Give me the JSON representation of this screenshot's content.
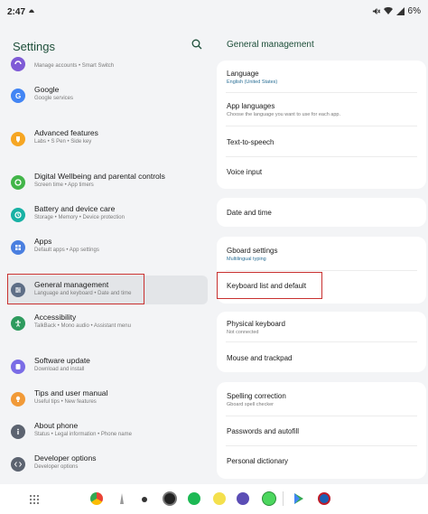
{
  "status_bar": {
    "time": "2:47",
    "battery": "6%"
  },
  "left": {
    "title": "Settings",
    "items": [
      {
        "label": "",
        "sub": "Manage accounts  •  Smart Switch"
      },
      {
        "label": "Google",
        "sub": "Google services"
      },
      {
        "label": "Advanced features",
        "sub": "Labs  •  S Pen  •  Side key"
      },
      {
        "label": "Digital Wellbeing and parental controls",
        "sub": "Screen time  •  App timers"
      },
      {
        "label": "Battery and device care",
        "sub": "Storage  •  Memory  •  Device protection"
      },
      {
        "label": "Apps",
        "sub": "Default apps  •  App settings"
      },
      {
        "label": "General management",
        "sub": "Language and keyboard  •  Date and time"
      },
      {
        "label": "Accessibility",
        "sub": "TalkBack  •  Mono audio  •  Assistant menu"
      },
      {
        "label": "Software update",
        "sub": "Download and install"
      },
      {
        "label": "Tips and user manual",
        "sub": "Useful tips  •  New features"
      },
      {
        "label": "About phone",
        "sub": "Status  •  Legal information  •  Phone name"
      },
      {
        "label": "Developer options",
        "sub": "Developer options"
      }
    ]
  },
  "right": {
    "title": "General management",
    "language": {
      "label": "Language",
      "value": "English (United States)"
    },
    "app_languages": {
      "label": "App languages",
      "sub": "Choose the language you want to use for each app."
    },
    "tts": "Text-to-speech",
    "voice_input": "Voice input",
    "date_time": "Date and time",
    "gboard": {
      "label": "Gboard settings",
      "value": "Multilingual typing"
    },
    "keyboard_list": "Keyboard list and default",
    "physical_keyboard": {
      "label": "Physical keyboard",
      "sub": "Not connected"
    },
    "mouse": "Mouse and trackpad",
    "spelling": {
      "label": "Spelling correction",
      "sub": "Gboard spell checker"
    },
    "passwords": "Passwords and autofill",
    "personal_dict": "Personal dictionary"
  },
  "colors": {
    "accent": "#1e4f3a",
    "highlight": "#c8302f"
  }
}
